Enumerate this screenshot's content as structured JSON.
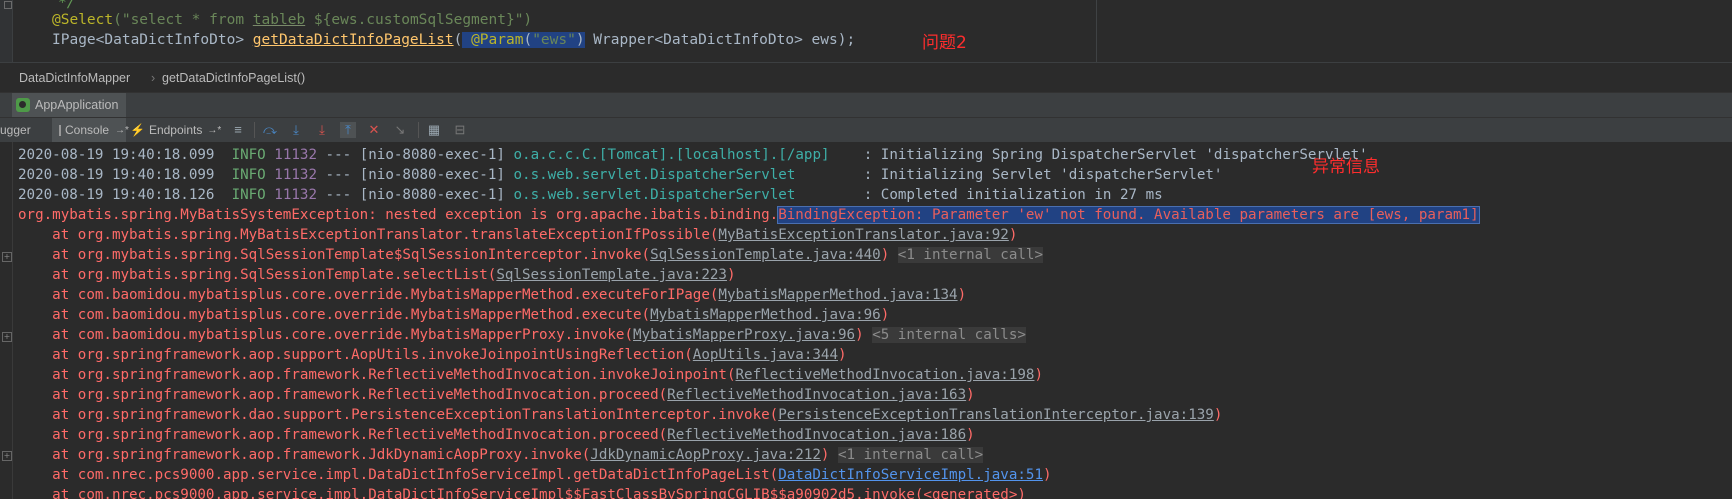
{
  "editor": {
    "comment_line": "*/",
    "select_annotation": "@Select",
    "select_open": "(\"select * from ",
    "select_table": "tableb",
    "select_rest": " ${ews.customSqlSegment}\")",
    "return_type": "IPage<DataDictInfoDto> ",
    "method_name": "getDataDictInfoPageList",
    "paren_open": "(",
    "param_annotation": "@Param",
    "param_value_open": "(",
    "param_value": "\"ews\"",
    "param_value_close": ")",
    "param_rest": " Wrapper<DataDictInfoDto> ews);",
    "question_label": "问题2"
  },
  "breadcrumb": {
    "items": [
      "DataDictInfoMapper",
      "getDataDictInfoPageList()"
    ],
    "separator": "›"
  },
  "run": {
    "tab_label": "AppApplication"
  },
  "toolbar": {
    "debugger_label": "ugger",
    "console_label": "Console",
    "console_arrow": "→*",
    "endpoints_label": "Endpoints",
    "endpoints_arrow": "→*",
    "icons": [
      "menu-icon",
      "step-over-icon",
      "step-into-icon",
      "force-step-into-icon",
      "step-out-icon",
      "drop-frame-icon",
      "run-to-cursor-icon",
      "evaluate-icon",
      "trace-icon"
    ]
  },
  "console": {
    "error_label": "异常信息",
    "log_lines": [
      {
        "ts": "2020-08-19 19:40:18.099",
        "level": "INFO",
        "pid": "11132",
        "sep": " --- ",
        "thread": "[nio-8080-exec-1]",
        "logger": "o.a.c.c.C.[Tomcat].[localhost].[/app]  ",
        "msg": ": Initializing Spring DispatcherServlet 'dispatcherServlet'"
      },
      {
        "ts": "2020-08-19 19:40:18.099",
        "level": "INFO",
        "pid": "11132",
        "sep": " --- ",
        "thread": "[nio-8080-exec-1]",
        "logger": "o.s.web.servlet.DispatcherServlet      ",
        "msg": ": Initializing Servlet 'dispatcherServlet'"
      },
      {
        "ts": "2020-08-19 19:40:18.126",
        "level": "INFO",
        "pid": "11132",
        "sep": " --- ",
        "thread": "[nio-8080-exec-1]",
        "logger": "o.s.web.servlet.DispatcherServlet      ",
        "msg": ": Completed initialization in 27 ms"
      }
    ],
    "exception_prefix": "org.mybatis.spring.MyBatisSystemException: nested exception is org.apache.ibatis.binding.",
    "exception_selected": "BindingException: Parameter 'ew' not found. Available parameters are [ews, param1]",
    "stack": [
      {
        "text": "    at org.mybatis.spring.MyBatisExceptionTranslator.translateExceptionIfPossible(",
        "link": "MyBatisExceptionTranslator.java:92",
        "close": ")",
        "extra": "",
        "fold": false,
        "blue": false
      },
      {
        "text": "    at org.mybatis.spring.SqlSessionTemplate$SqlSessionInterceptor.invoke(",
        "link": "SqlSessionTemplate.java:440",
        "close": ")",
        "extra": "<1 internal call>",
        "fold": true,
        "blue": false
      },
      {
        "text": "    at org.mybatis.spring.SqlSessionTemplate.selectList(",
        "link": "SqlSessionTemplate.java:223",
        "close": ")",
        "extra": "",
        "fold": false,
        "blue": false
      },
      {
        "text": "    at com.baomidou.mybatisplus.core.override.MybatisMapperMethod.executeForIPage(",
        "link": "MybatisMapperMethod.java:134",
        "close": ")",
        "extra": "",
        "fold": false,
        "blue": false
      },
      {
        "text": "    at com.baomidou.mybatisplus.core.override.MybatisMapperMethod.execute(",
        "link": "MybatisMapperMethod.java:96",
        "close": ")",
        "extra": "",
        "fold": false,
        "blue": false
      },
      {
        "text": "    at com.baomidou.mybatisplus.core.override.MybatisMapperProxy.invoke(",
        "link": "MybatisMapperProxy.java:96",
        "close": ")",
        "extra": "<5 internal calls>",
        "fold": true,
        "blue": false
      },
      {
        "text": "    at org.springframework.aop.support.AopUtils.invokeJoinpointUsingReflection(",
        "link": "AopUtils.java:344",
        "close": ")",
        "extra": "",
        "fold": false,
        "blue": false
      },
      {
        "text": "    at org.springframework.aop.framework.ReflectiveMethodInvocation.invokeJoinpoint(",
        "link": "ReflectiveMethodInvocation.java:198",
        "close": ")",
        "extra": "",
        "fold": false,
        "blue": false
      },
      {
        "text": "    at org.springframework.aop.framework.ReflectiveMethodInvocation.proceed(",
        "link": "ReflectiveMethodInvocation.java:163",
        "close": ")",
        "extra": "",
        "fold": false,
        "blue": false
      },
      {
        "text": "    at org.springframework.dao.support.PersistenceExceptionTranslationInterceptor.invoke(",
        "link": "PersistenceExceptionTranslationInterceptor.java:139",
        "close": ")",
        "extra": "",
        "fold": false,
        "blue": false
      },
      {
        "text": "    at org.springframework.aop.framework.ReflectiveMethodInvocation.proceed(",
        "link": "ReflectiveMethodInvocation.java:186",
        "close": ")",
        "extra": "",
        "fold": false,
        "blue": false
      },
      {
        "text": "    at org.springframework.aop.framework.JdkDynamicAopProxy.invoke(",
        "link": "JdkDynamicAopProxy.java:212",
        "close": ")",
        "extra": "<1 internal call>",
        "fold": true,
        "blue": false
      },
      {
        "text": "    at com.nrec.pcs9000.app.service.impl.DataDictInfoServiceImpl.getDataDictInfoPageList(",
        "link": "DataDictInfoServiceImpl.java:51",
        "close": ")",
        "extra": "",
        "fold": false,
        "blue": true
      },
      {
        "text": "    at com.nrec.pcs9000.app.service.impl.DataDictInfoServiceImpl$$FastClassBySpringCGLIB$$a90902d5.invoke(<generated>)",
        "link": "",
        "close": "",
        "extra": "",
        "fold": false,
        "blue": false
      }
    ]
  }
}
